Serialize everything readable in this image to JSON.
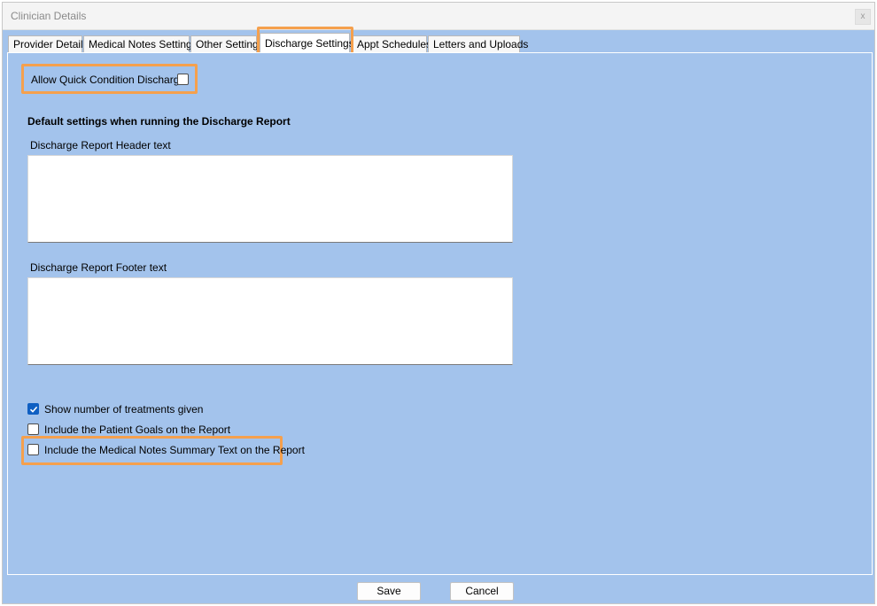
{
  "window": {
    "title": "Clinician Details",
    "close_label": "x"
  },
  "tabs": [
    {
      "label": "Provider Details"
    },
    {
      "label": "Medical Notes Settings"
    },
    {
      "label": "Other Settings"
    },
    {
      "label": "Discharge Settings",
      "active": true
    },
    {
      "label": "Appt Schedules"
    },
    {
      "label": "Letters and Uploads"
    }
  ],
  "discharge": {
    "quick_condition_label": "Allow Quick Condition Discharge",
    "quick_condition_checked": false,
    "section_heading": "Default settings when running the Discharge Report",
    "header_text_label": "Discharge Report Header text",
    "header_text_value": "",
    "footer_text_label": "Discharge Report Footer text",
    "footer_text_value": "",
    "options": [
      {
        "label": "Show number of treatments given",
        "checked": true
      },
      {
        "label": "Include the Patient Goals on the Report",
        "checked": false
      },
      {
        "label": "Include the Medical Notes Summary Text on the Report",
        "checked": false
      }
    ]
  },
  "footer": {
    "save_label": "Save",
    "cancel_label": "Cancel"
  },
  "colors": {
    "background": "#a3c3ec",
    "highlight": "#f5a04d",
    "checkbox_checked": "#0f5fc2"
  }
}
